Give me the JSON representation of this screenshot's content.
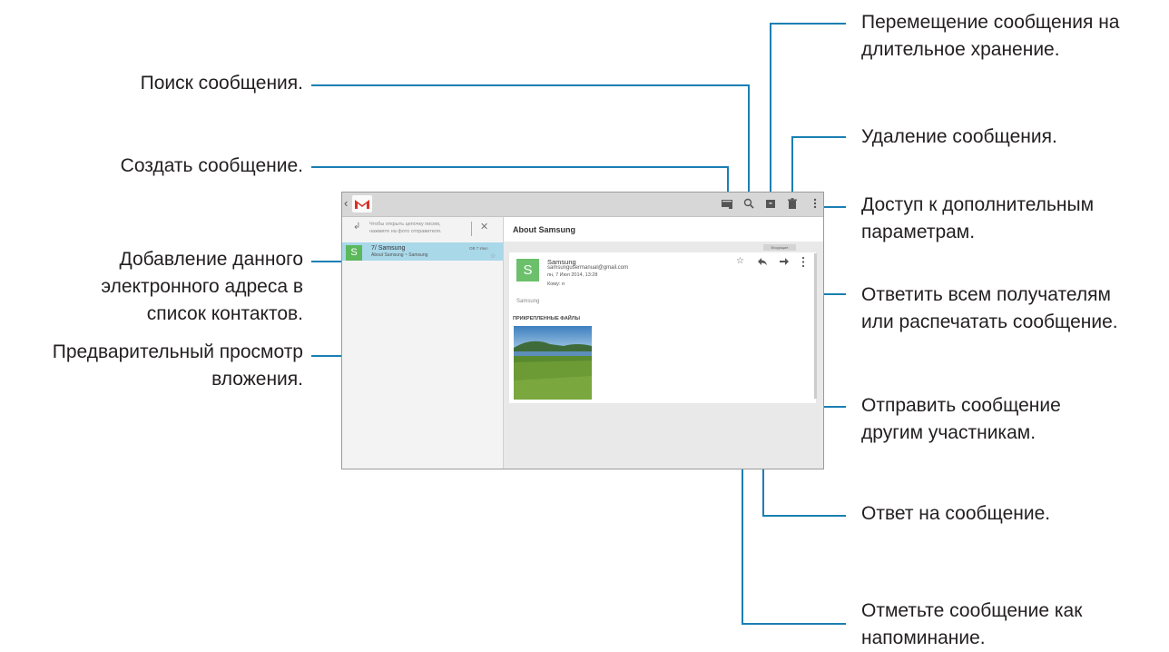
{
  "callouts": {
    "search": "Поиск сообщения.",
    "compose": "Создать сообщение.",
    "add_contact": [
      "Добавление данного",
      "электронного адреса в",
      "список контактов."
    ],
    "preview": [
      "Предварительный просмотр",
      "вложения."
    ],
    "archive": [
      "Перемещение сообщения на",
      "длительное хранение."
    ],
    "delete": "Удаление сообщения.",
    "more_options": [
      "Доступ к дополнительным",
      "параметрам."
    ],
    "reply_all": [
      "Ответить всем получателям",
      "или распечатать сообщение."
    ],
    "forward": [
      "Отправить сообщение",
      "другим участникам."
    ],
    "reply": "Ответ на сообщение.",
    "star": [
      "Отметьте сообщение как",
      "напоминание."
    ]
  },
  "screen": {
    "hint": [
      "Чтобы открыть цепочку писем,",
      "нажмите на фото отправителя."
    ],
    "conversation": {
      "avatar": "S",
      "name": "7/ Samsung",
      "subject": "About Samsung ~ Samsung",
      "date": "ОВ  7 Июл"
    },
    "subject": "About Samsung",
    "label": "Входящие",
    "sender": {
      "avatar": "S",
      "name": "Samsung",
      "email": "samsungusermanual@gmail.com",
      "date": "пн, 7 Июл 2014, 13:28",
      "to": "Кому: я"
    },
    "body": "Samsung",
    "attachments_title": "ПРИКРЕПЛЕННЫЕ ФАЙЛЫ"
  },
  "colors": {
    "leader": "#1a7fb3",
    "gmail_red": "#d93025",
    "avatar_green": "#6cc06c",
    "selected_row": "#a9d8e9"
  },
  "icons": [
    "back-icon",
    "gmail-logo",
    "compose-icon",
    "search-icon",
    "archive-icon",
    "delete-icon",
    "overflow-menu-icon",
    "star-icon",
    "reply-icon",
    "forward-icon",
    "more-icon"
  ]
}
